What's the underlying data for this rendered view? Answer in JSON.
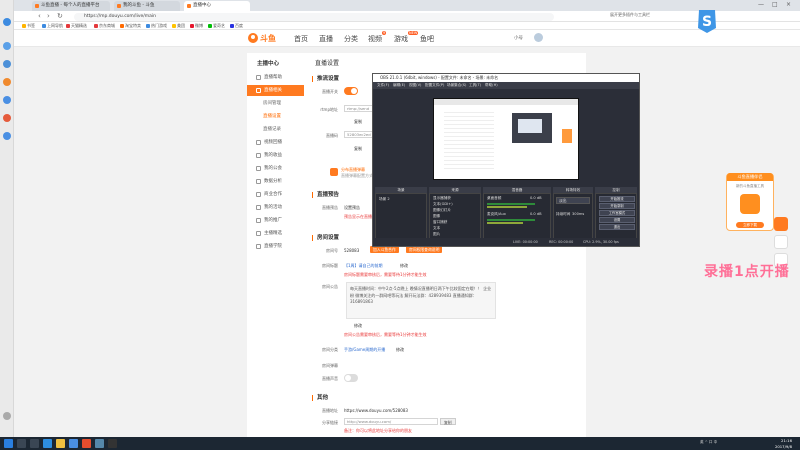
{
  "browser": {
    "tabs": [
      {
        "label": "斗鱼直播 - 每个人的直播平台",
        "active": false
      },
      {
        "label": "我的斗鱼 - 斗鱼",
        "active": false
      },
      {
        "label": "直播中心",
        "active": true
      }
    ],
    "url": "https://mp.douyu.com/live/main",
    "bookmarks": [
      "书签",
      "上网导航",
      "天猫精选",
      "京东商城",
      "淘宝特卖",
      "热门游戏",
      "美团",
      "微博",
      "爱奇艺",
      "百度"
    ],
    "top_right_text": "展开更多插件与工具栏",
    "window_controls": [
      "—",
      "□",
      "×"
    ]
  },
  "site": {
    "logo_text": "斗鱼",
    "nav": [
      "首页",
      "直播",
      "分类",
      "视频",
      "游戏",
      "鱼吧"
    ],
    "nav_badges": {
      "视频": "9",
      "游戏": "NEW"
    },
    "user_label": "小号"
  },
  "left_menu": {
    "title": "主播中心",
    "items": [
      {
        "label": "直播帮助",
        "active": false
      },
      {
        "label": "直播相关",
        "active": true
      },
      {
        "label": "房间管理",
        "active": false,
        "sub": true
      },
      {
        "label": "直播设置",
        "active": false,
        "sub": true,
        "selected": true
      },
      {
        "label": "直播记录",
        "active": false,
        "sub": true
      },
      {
        "label": "视频回播",
        "active": false
      },
      {
        "label": "我的收益",
        "active": false
      },
      {
        "label": "我的公会",
        "active": false
      },
      {
        "label": "数据分析",
        "active": false
      },
      {
        "label": "商业合作",
        "active": false
      },
      {
        "label": "我的活动",
        "active": false
      },
      {
        "label": "我的推广",
        "active": false
      },
      {
        "label": "主播精选",
        "active": false
      },
      {
        "label": "直播学院",
        "active": false
      }
    ]
  },
  "main": {
    "page_title": "直播设置",
    "section1": {
      "title": "推流设置",
      "fields": [
        {
          "label": "直播开关",
          "value": ""
        },
        {
          "label": "rtmp地址",
          "value": "rtmp://send"
        },
        {
          "label": "直播码",
          "value": "52803ec2ed"
        }
      ],
      "copy_label": "复制",
      "tip": "分布直播弹幕",
      "tip_sub": "直播弹幕配置方式"
    },
    "section2": {
      "title": "直播预告",
      "label": "直播预告",
      "value": "设置预告",
      "note": "预告显示在直播间"
    },
    "section3": {
      "title": "房间设置",
      "room_id_label": "房间号",
      "room_id": "528083",
      "room_btn1": "加入斗鱼合作",
      "room_btn2": "房间权限查询说明",
      "room_name_label": "房间标题",
      "room_name": "【1周】请自己的前期",
      "modify": "修改",
      "name_note": "房间标题需要审核后，需要等待1分钟才能生效",
      "notice_label": "房间公告",
      "notice_text": "每天直播时间：中午2点-5点晚上 晚情况直播明日两下午比较固定在哦！！ 企业粉 微博关注的一群网吧等玩法 解开玩法群：428939483 直播通知群：316891863",
      "notice_note": "房间公告需要审核后，需要等待1分钟才能生效",
      "category_label": "房间分类",
      "category_value": "手游/Game周期的开播",
      "chat_label": "房间弹幕",
      "live_switch_label": "直播声音"
    },
    "section4": {
      "title": "其他",
      "url_label": "直播地址",
      "url_value": "https://www.douyu.com/528083",
      "share_label": "分享链接",
      "share_value": "http://www.douyu.com/",
      "copy": "复制",
      "share_note": "备注：你可以将此地址分享给你的朋友"
    }
  },
  "obs": {
    "title": "OBS 21.0.1 (64bit, windows) - 配置文件: 未命名 - 场景: 未命名",
    "menu": [
      "文件(F)",
      "编辑(E)",
      "视图(V)",
      "配置文件(P)",
      "场景集合(S)",
      "工具(T)",
      "帮助(H)"
    ],
    "docks": [
      "场景",
      "来源",
      "混音器",
      "转场特效",
      "控制"
    ],
    "scene_item": "场景 2",
    "sources": [
      "显示器捕获",
      "文本(GDI+)",
      "图像幻灯片",
      "图像",
      "窗口捕获",
      "文本",
      "图片"
    ],
    "mixer": [
      {
        "name": "桌面音频",
        "value": "0.0 dB"
      },
      {
        "name": "麦克风/Aux",
        "value": "0.0 dB"
      }
    ],
    "transition_name": "淡出",
    "transition_duration_label": "持续时间",
    "transition_duration": "300ms",
    "controls": [
      "开始推流",
      "开始录制",
      "工作室模式",
      "设置",
      "退出"
    ],
    "status": [
      "LIVE: 00:00:00",
      "REC: 00:00:00",
      "CPU: 2.9%, 30.00 fps"
    ]
  },
  "promo": {
    "title": "斗鱼直播伴侣",
    "subtitle": "新的斗鱼直播工具",
    "button": "立即下载"
  },
  "overlay_text": "录播1点开播",
  "taskbar": {
    "time": "21:16",
    "date": "2017/9/8",
    "tray": "英 ^ 口 中"
  },
  "colors": {
    "accent": "#ff7a20",
    "link": "#2d6bcf",
    "warning": "#e93a3a",
    "obs_bg": "#2b2e38",
    "taskbar": "#1c2733"
  }
}
